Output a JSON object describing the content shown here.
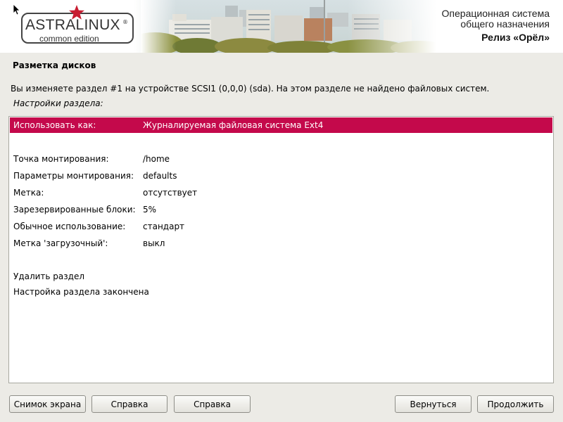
{
  "header": {
    "logo_main": "ASTRALINUX",
    "logo_reg": "®",
    "logo_sub": "common edition",
    "os_line1": "Операционная система",
    "os_line2": "общего назначения",
    "release": "Релиз «Орёл»"
  },
  "page": {
    "title": "Разметка дисков",
    "info": "Вы изменяете раздел #1 на устройстве SCSI1 (0,0,0) (sda). На этом разделе не найдено файловых систем.",
    "subtitle": "Настройки раздела:"
  },
  "settings": {
    "use_as": {
      "key": "Использовать как:",
      "value": "Журналируемая файловая система Ext4"
    },
    "mount_point": {
      "key": "Точка монтирования:",
      "value": "/home"
    },
    "mount_options": {
      "key": "Параметры монтирования:",
      "value": "defaults"
    },
    "label": {
      "key": "Метка:",
      "value": "отсутствует"
    },
    "reserved": {
      "key": "Зарезервированные блоки:",
      "value": "5%"
    },
    "usage": {
      "key": "Обычное использование:",
      "value": "стандарт"
    },
    "bootable": {
      "key": "Метка 'загрузочный':",
      "value": "выкл"
    },
    "delete": "Удалить раздел",
    "done": "Настройка раздела закончена"
  },
  "buttons": {
    "screenshot": "Снимок экрана",
    "help1": "Справка",
    "help2": "Справка",
    "back": "Вернуться",
    "continue": "Продолжить"
  },
  "colors": {
    "selection": "#c4094b",
    "logo_star": "#c81e32"
  },
  "icons": {
    "logo_star": "star-icon",
    "cursor": "mouse-pointer-icon"
  }
}
